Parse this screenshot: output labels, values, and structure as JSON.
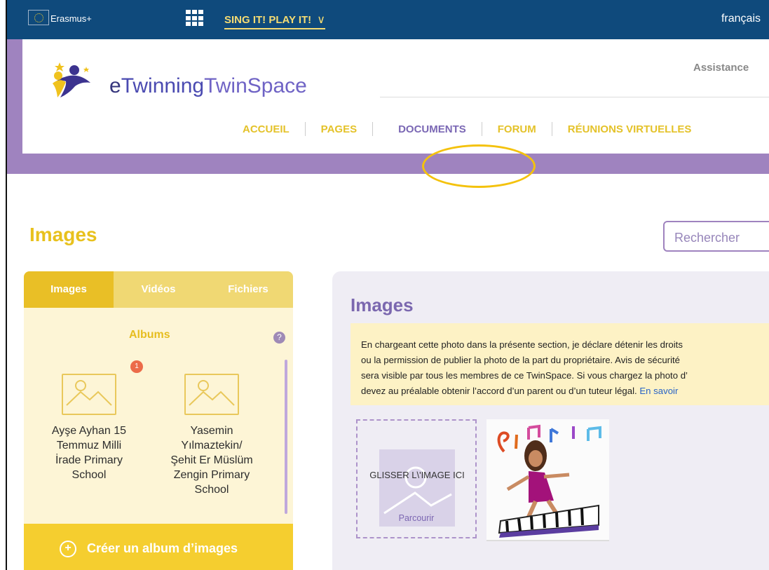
{
  "top_bar": {
    "erasmus": "Erasmus+",
    "project_name": "SING IT! PLAY IT!",
    "language": "français"
  },
  "header": {
    "logo_e": "e",
    "logo_twinning": "Twinning",
    "logo_space": "TwinSpace",
    "assistance": "Assistance"
  },
  "nav": {
    "home": "ACCUEIL",
    "pages": "PAGES",
    "documents": "DOCUMENTS",
    "forum": "FORUM",
    "meetings": "RÉUNIONS VIRTUELLES"
  },
  "page": {
    "title": "Images",
    "search_placeholder": "Rechercher"
  },
  "left_panel": {
    "tabs": {
      "images": "Images",
      "videos": "Vidéos",
      "files": "Fichiers"
    },
    "albums_title": "Albums",
    "help": "?",
    "albums": {
      "a1": {
        "badge": "1",
        "line1": "Ayşe Ayhan 15",
        "line2": "Temmuz Milli",
        "line3": "İrade Primary",
        "line4": "School"
      },
      "a2": {
        "line1": "Yasemin",
        "line2": "Yılmaztekin/",
        "line3": "Şehit Er Müslüm",
        "line4": "Zengin Primary",
        "line5": "School"
      }
    },
    "create_icon": "+",
    "create_album": "Créer un album d’images"
  },
  "main": {
    "title": "Images",
    "notice": {
      "line1": "En chargeant cette photo dans la présente section, je déclare détenir les droits",
      "line2": "ou la permission de publier la photo de la part du propriétaire. Avis de sécurité",
      "line3": "sera visible par tous les membres de ce TwinSpace. Si vous chargez la photo d’",
      "line4": "devez au préalable obtenir l’accord d’un parent ou d’un tuteur légal.",
      "link": "En savoir"
    },
    "drop": {
      "text": "GLISSER L\\'IMAGE ICI",
      "browse": "Parcourir"
    }
  }
}
